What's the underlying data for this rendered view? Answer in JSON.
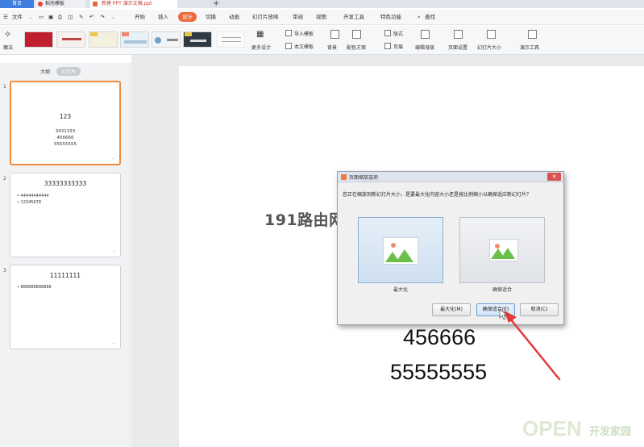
{
  "tabs": {
    "home": "首页",
    "templates": "稻壳模板",
    "document": "新建 PPT 演示文稿.ppt",
    "add": "+"
  },
  "menu": {
    "file": "文件",
    "items": [
      "开始",
      "插入",
      "设计",
      "切换",
      "动画",
      "幻灯片放映",
      "审阅",
      "视图",
      "开发工具",
      "特色功能"
    ],
    "search": "查找"
  },
  "ribbon": {
    "magic": "魔法",
    "more_design": "更多设计",
    "import_template": "导入模板",
    "text_template": "本文模板",
    "background": "背景",
    "color_scheme": "配色方案",
    "layout": "版式",
    "header": "页眉",
    "edit_master": "编辑母版",
    "page_setup": "页面设置",
    "slide_size": "幻灯片大小",
    "present_tools": "演示工具"
  },
  "left_panel": {
    "tab_outline": "大纲",
    "tab_slides": "幻灯片",
    "slides": [
      {
        "num": "1",
        "title": "123",
        "lines": [
          "3431333",
          "456666",
          "55555555"
        ],
        "bullets": []
      },
      {
        "num": "2",
        "title": "33333333333",
        "lines": [],
        "bullets": [
          "44444444444",
          "12345678"
        ]
      },
      {
        "num": "3",
        "title": "11111111",
        "lines": [],
        "bullets": [
          "888888888888"
        ]
      }
    ]
  },
  "slide_canvas": {
    "text1": "456666",
    "text2": "55555555"
  },
  "watermarks": {
    "site": "191路由网",
    "open": "OPEN",
    "open_cn": "开发家园"
  },
  "dialog": {
    "title": "页面缩放选项",
    "message": "您正在缩放到新幻灯片大小，是要最大化内容大小还是按比例缩小以确保适应新幻灯片？",
    "option_max": "最大化",
    "option_fit": "确保适合",
    "btn_max": "最大化(M)",
    "btn_fit": "确保适合(E)",
    "btn_cancel": "取消(C)"
  },
  "colors": {
    "accent": "#ee6a3c",
    "home_tab": "#3f7de0",
    "arrow": "#e53935"
  }
}
